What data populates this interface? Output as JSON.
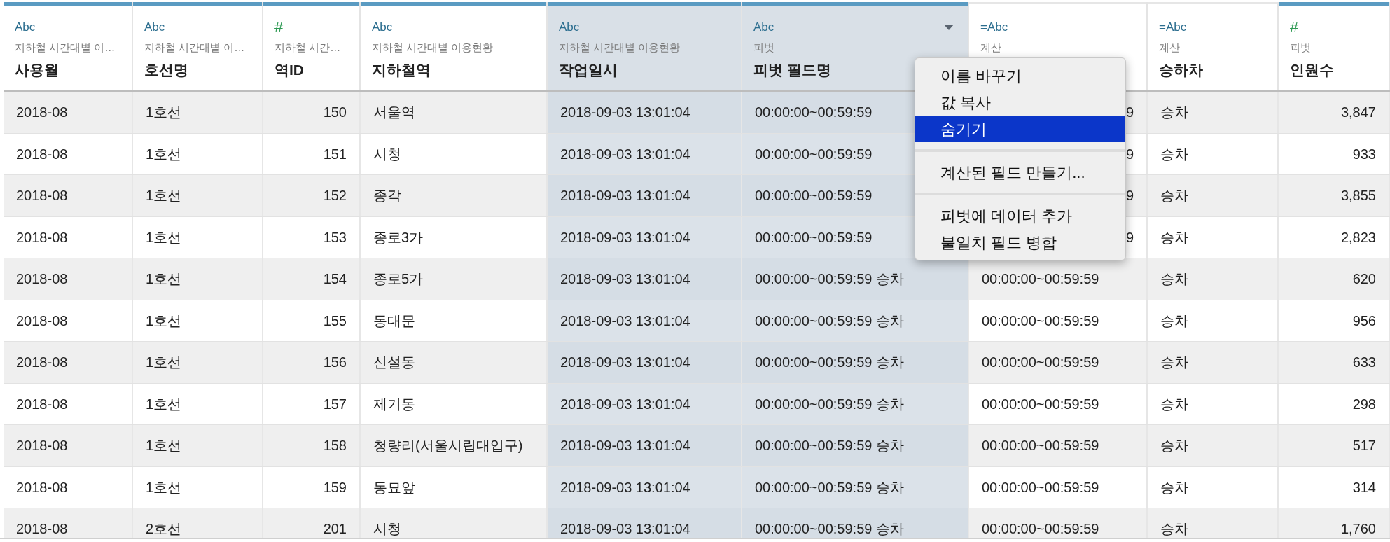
{
  "columns": [
    {
      "kind": "string",
      "type_label": "Abc",
      "source": "지하철 시간대별 이…",
      "name": "사용월",
      "selected": false,
      "menu_caret": false
    },
    {
      "kind": "string",
      "type_label": "Abc",
      "source": "지하철 시간대별 이…",
      "name": "호선명",
      "selected": false,
      "menu_caret": false
    },
    {
      "kind": "number",
      "type_label": "#",
      "source": "지하철 시간…",
      "name": "역ID",
      "selected": false,
      "menu_caret": false
    },
    {
      "kind": "string",
      "type_label": "Abc",
      "source": "지하철 시간대별 이용현황",
      "name": "지하철역",
      "selected": false,
      "menu_caret": false
    },
    {
      "kind": "string",
      "type_label": "Abc",
      "source": "지하철 시간대별 이용현황",
      "name": "작업일시",
      "selected": true,
      "menu_caret": false
    },
    {
      "kind": "string",
      "type_label": "Abc",
      "source": "피벗",
      "name": "피벗 필드명",
      "selected": true,
      "menu_caret": true
    },
    {
      "kind": "calc",
      "type_label": "=Abc",
      "source": "계산",
      "selected": false,
      "menu_caret": false
    },
    {
      "kind": "calc",
      "type_label": "=Abc",
      "source": "계산",
      "name": "승하차",
      "selected": false,
      "menu_caret": false
    },
    {
      "kind": "number",
      "type_label": "#",
      "source": "피벗",
      "name": "인원수",
      "selected": false,
      "menu_caret": false
    }
  ],
  "rows": [
    {
      "covered": true,
      "cells": [
        "2018-08",
        "1호선",
        "150",
        "서울역",
        "2018-09-03 13:01:04",
        "00:00:00~00:59:59",
        "9",
        "승차",
        "3,847"
      ]
    },
    {
      "covered": true,
      "cells": [
        "2018-08",
        "1호선",
        "151",
        "시청",
        "2018-09-03 13:01:04",
        "00:00:00~00:59:59",
        "9",
        "승차",
        "933"
      ]
    },
    {
      "covered": true,
      "cells": [
        "2018-08",
        "1호선",
        "152",
        "종각",
        "2018-09-03 13:01:04",
        "00:00:00~00:59:59",
        "9",
        "승차",
        "3,855"
      ]
    },
    {
      "covered": true,
      "cells": [
        "2018-08",
        "1호선",
        "153",
        "종로3가",
        "2018-09-03 13:01:04",
        "00:00:00~00:59:59",
        "9",
        "승차",
        "2,823"
      ]
    },
    {
      "covered": false,
      "cells": [
        "2018-08",
        "1호선",
        "154",
        "종로5가",
        "2018-09-03 13:01:04",
        "00:00:00~00:59:59 승차",
        "00:00:00~00:59:59",
        "승차",
        "620"
      ]
    },
    {
      "covered": false,
      "cells": [
        "2018-08",
        "1호선",
        "155",
        "동대문",
        "2018-09-03 13:01:04",
        "00:00:00~00:59:59 승차",
        "00:00:00~00:59:59",
        "승차",
        "956"
      ]
    },
    {
      "covered": false,
      "cells": [
        "2018-08",
        "1호선",
        "156",
        "신설동",
        "2018-09-03 13:01:04",
        "00:00:00~00:59:59 승차",
        "00:00:00~00:59:59",
        "승차",
        "633"
      ]
    },
    {
      "covered": false,
      "cells": [
        "2018-08",
        "1호선",
        "157",
        "제기동",
        "2018-09-03 13:01:04",
        "00:00:00~00:59:59 승차",
        "00:00:00~00:59:59",
        "승차",
        "298"
      ]
    },
    {
      "covered": false,
      "cells": [
        "2018-08",
        "1호선",
        "158",
        "청량리(서울시립대입구)",
        "2018-09-03 13:01:04",
        "00:00:00~00:59:59 승차",
        "00:00:00~00:59:59",
        "승차",
        "517"
      ]
    },
    {
      "covered": false,
      "cells": [
        "2018-08",
        "1호선",
        "159",
        "동묘앞",
        "2018-09-03 13:01:04",
        "00:00:00~00:59:59 승차",
        "00:00:00~00:59:59",
        "승차",
        "314"
      ]
    },
    {
      "covered": false,
      "cells": [
        "2018-08",
        "2호선",
        "201",
        "시청",
        "2018-09-03 13:01:04",
        "00:00:00~00:59:59 승차",
        "00:00:00~00:59:59",
        "승차",
        "1,760"
      ]
    }
  ],
  "context_menu": [
    {
      "kind": "item",
      "label": "이름 바꾸기",
      "selected": false
    },
    {
      "kind": "item",
      "label": "값 복사",
      "selected": false
    },
    {
      "kind": "item",
      "label": "숨기기",
      "selected": true
    },
    {
      "kind": "separator"
    },
    {
      "kind": "item",
      "label": "계산된 필드 만들기...",
      "selected": false
    },
    {
      "kind": "separator"
    },
    {
      "kind": "item",
      "label": "피벗에 데이터 추가",
      "selected": false
    },
    {
      "kind": "item",
      "label": "불일치 필드 병합",
      "selected": false
    }
  ]
}
